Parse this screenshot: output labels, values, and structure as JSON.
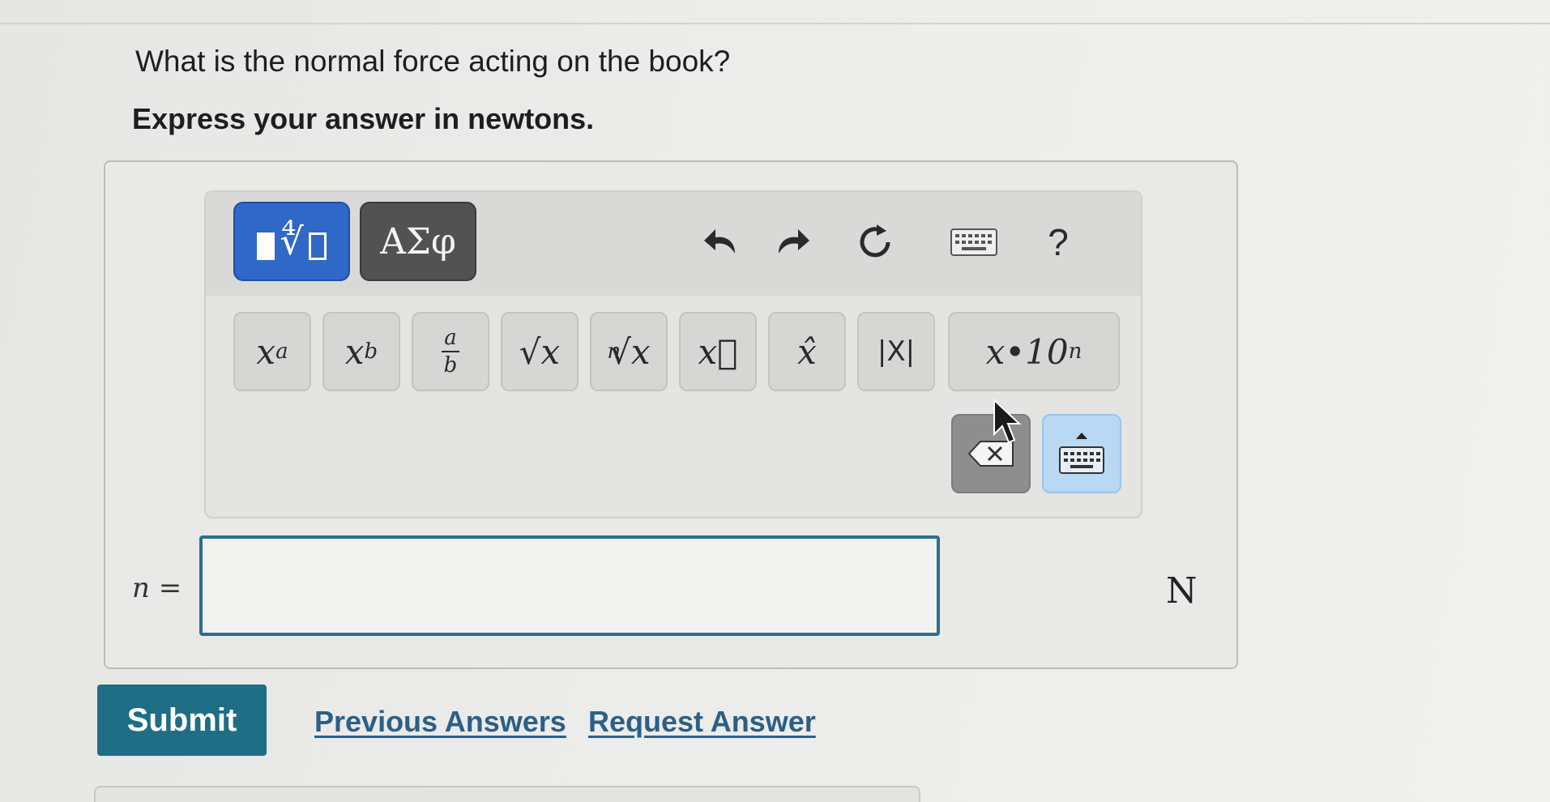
{
  "question": {
    "prompt": "What is the normal force acting on the book?",
    "instruction": "Express your answer in newtons."
  },
  "toolbar": {
    "modes": [
      {
        "name": "templates",
        "label": "",
        "icon": "templates-icon",
        "active": true
      },
      {
        "name": "greek",
        "label": "ΑΣφ",
        "active": false
      }
    ],
    "controls": [
      {
        "name": "undo",
        "icon": "undo-icon"
      },
      {
        "name": "redo",
        "icon": "redo-icon"
      },
      {
        "name": "reset",
        "icon": "reset-icon"
      },
      {
        "name": "keyboard-shortcuts",
        "icon": "keyboard-icon"
      },
      {
        "name": "help",
        "label": "?"
      }
    ],
    "symbols": [
      {
        "name": "superscript",
        "base": "x",
        "mod": "a"
      },
      {
        "name": "subscript",
        "base": "x",
        "mod": "b"
      },
      {
        "name": "fraction",
        "num": "a",
        "den": "b"
      },
      {
        "name": "square-root",
        "label": "√x"
      },
      {
        "name": "nth-root",
        "index": "n",
        "label": "√x"
      },
      {
        "name": "vector",
        "label": "x⃗"
      },
      {
        "name": "unit-vector",
        "label": "x̂"
      },
      {
        "name": "absolute-value",
        "label": "|X|"
      },
      {
        "name": "scientific-notation",
        "label": "x•10",
        "mod": "n"
      }
    ],
    "backspace_icon": "backspace-icon",
    "keyboard_toggle_icon": "keyboard-toggle-icon"
  },
  "answer": {
    "variable_label": "n =",
    "value": "",
    "unit": "N"
  },
  "actions": {
    "submit_label": "Submit",
    "previous_answers_label": "Previous Answers",
    "request_answer_label": "Request Answer"
  },
  "colors": {
    "submit_bg": "#1e6e85",
    "active_mode_bg": "#2f68c6",
    "link": "#2c5f86",
    "input_border": "#2c6f8a"
  }
}
